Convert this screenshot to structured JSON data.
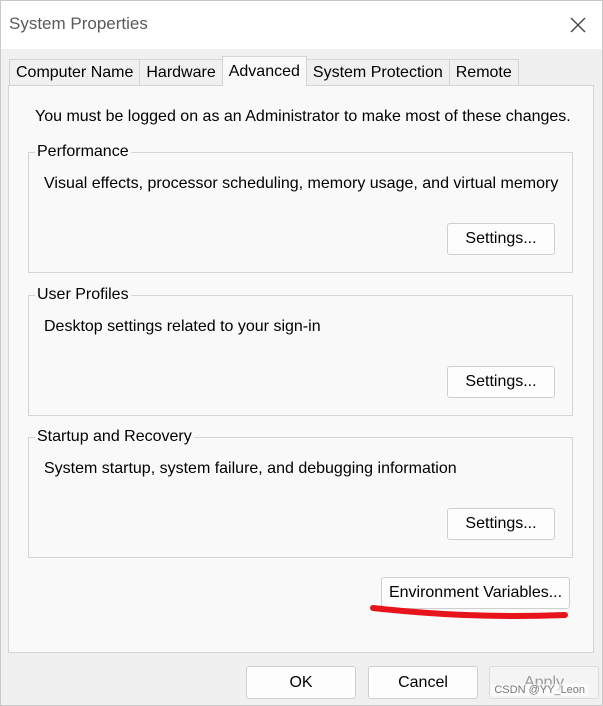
{
  "window": {
    "title": "System Properties"
  },
  "tabs": [
    {
      "label": "Computer Name",
      "active": false
    },
    {
      "label": "Hardware",
      "active": false
    },
    {
      "label": "Advanced",
      "active": true
    },
    {
      "label": "System Protection",
      "active": false
    },
    {
      "label": "Remote",
      "active": false
    }
  ],
  "advanced": {
    "admin_note": "You must be logged on as an Administrator to make most of these changes.",
    "performance": {
      "title": "Performance",
      "description": "Visual effects, processor scheduling, memory usage, and virtual memory",
      "button_label": "Settings..."
    },
    "user_profiles": {
      "title": "User Profiles",
      "description": "Desktop settings related to your sign-in",
      "button_label": "Settings..."
    },
    "startup_recovery": {
      "title": "Startup and Recovery",
      "description": "System startup, system failure, and debugging information",
      "button_label": "Settings..."
    },
    "environment_variables_label": "Environment Variables..."
  },
  "footer": {
    "ok_label": "OK",
    "cancel_label": "Cancel",
    "apply_label": "Apply"
  },
  "watermark": "CSDN @YY_Leon",
  "colors": {
    "annotation_red": "#e8141b",
    "panel_bg": "#f9f9f9",
    "window_bg": "#f0f0f0",
    "disabled_text": "#9c9c9c"
  },
  "icons": {
    "close": "close-icon"
  }
}
